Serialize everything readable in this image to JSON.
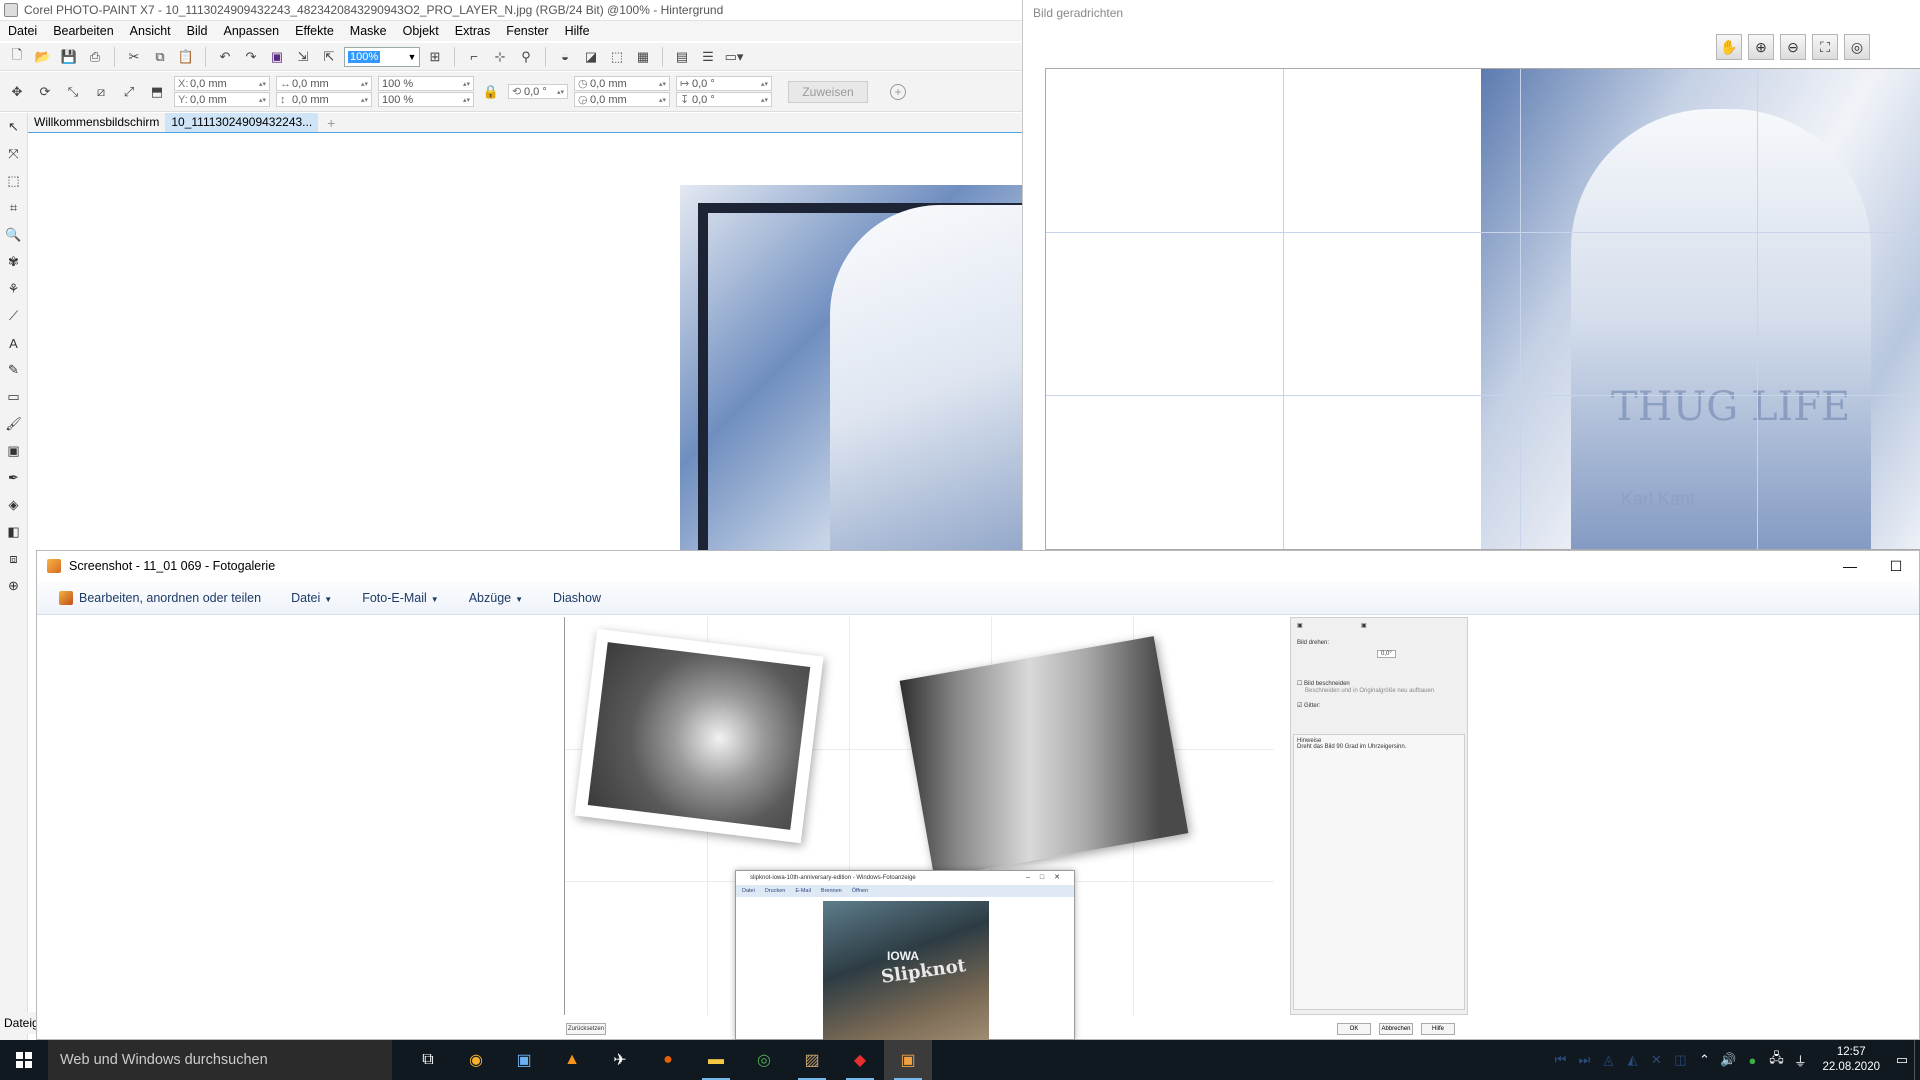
{
  "corel": {
    "title": "Corel PHOTO-PAINT X7 - 10_1113024909432243_4823420843290943O2_PRO_LAYER_N.jpg (RGB/24 Bit) @100% - Hintergrund",
    "menu": [
      "Datei",
      "Bearbeiten",
      "Ansicht",
      "Bild",
      "Anpassen",
      "Effekte",
      "Maske",
      "Objekt",
      "Extras",
      "Fenster",
      "Hilfe"
    ],
    "zoom_value": "100%",
    "fields": {
      "x": "0,0 mm",
      "y": "0,0 mm",
      "w": "0,0 mm",
      "h": "0,0 mm",
      "scale_w": "100 %",
      "scale_h": "100 %",
      "rotate": "0,0 °",
      "center_x": "0,0 mm",
      "center_y": "0,0 mm",
      "skew_h": "0,0 °",
      "skew_v": "0,0 °"
    },
    "assign_label": "Zuweisen",
    "tabs": [
      "Willkommensbildschirm",
      "10_11113024909432243..."
    ],
    "status_text": "Dateig"
  },
  "straighten": {
    "title": "Bild geradrichten",
    "tattoo_text": "THUG LIFE",
    "waist_text": "Karl Kant"
  },
  "gallery": {
    "title": "Screenshot - 11_01 069 - Fotogalerie",
    "menu": {
      "edit": "Bearbeiten, anordnen oder teilen",
      "file": "Datei",
      "email": "Foto-E-Mail",
      "prints": "Abzüge",
      "slideshow": "Diashow"
    },
    "reset_label": "Zurücksetzen",
    "panel": {
      "rotate_label": "Bild drehen:",
      "rotate_value": "0,0°",
      "crop_label": "Bild beschneiden",
      "crop_sub": "Beschneiden und in Originalgröße neu aufbauen",
      "grid_label": "Gitter:",
      "hint_title": "Hinweise",
      "hint_text": "Dreht das Bild 90 Grad im Uhrzeigersinn."
    },
    "buttons": [
      "OK",
      "Abbrechen",
      "Hilfe"
    ],
    "inner_window": {
      "title": "slipknot-iowa-10th-anniversary-edition - Windows-Fotoanzeige",
      "menu": [
        "Datei",
        "Drucken",
        "E-Mail",
        "Brennen",
        "Öffnen"
      ],
      "cover_top": "IOWA",
      "cover_main": "Slipknot"
    }
  },
  "taskbar": {
    "search_placeholder": "Web und Windows durchsuchen",
    "time": "12:57",
    "date": "22.08.2020"
  }
}
